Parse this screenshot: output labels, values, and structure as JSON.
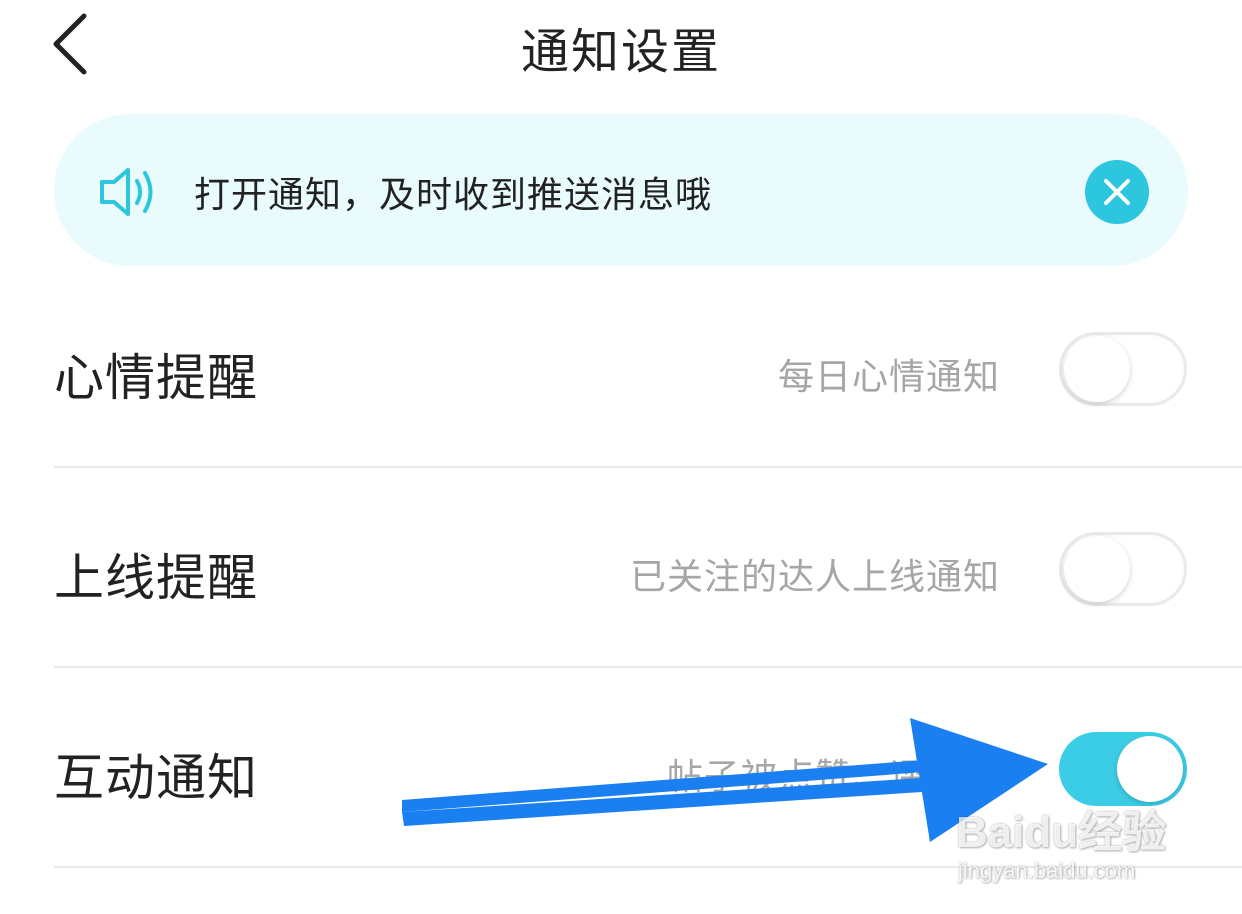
{
  "header": {
    "title": "通知设置",
    "back_icon": "chevron-left-icon"
  },
  "banner": {
    "icon": "speaker-icon",
    "text": "打开通知，及时收到推送消息哦",
    "close_icon": "close-icon",
    "accent_color": "#2cc6df",
    "background_color": "#e9fbfd"
  },
  "settings": [
    {
      "label": "心情提醒",
      "description": "每日心情通知",
      "enabled": false
    },
    {
      "label": "上线提醒",
      "description": "已关注的达人上线通知",
      "enabled": false
    },
    {
      "label": "互动通知",
      "description": "帖子被点赞、评论和",
      "enabled": true
    }
  ],
  "annotation": {
    "icon": "arrow-icon",
    "color": "#1a7ff0"
  },
  "watermark": {
    "brand": "Baidu经验",
    "url": "jingyan.baidu.com"
  },
  "colors": {
    "toggle_on": "#3ccde6",
    "description_text": "#a6a6a6"
  }
}
